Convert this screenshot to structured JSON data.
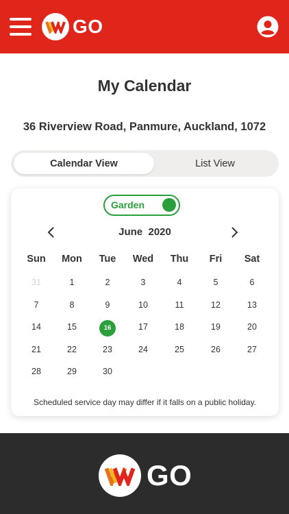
{
  "header": {
    "logo_text": "GO"
  },
  "page": {
    "title": "My Calendar",
    "address": "36 Riverview Road, Panmure, Auckland, 1072"
  },
  "view_toggle": {
    "calendar_label": "Calendar View",
    "list_label": "List View",
    "selected": "Calendar View"
  },
  "calendar": {
    "filter_label": "Garden",
    "filter_on": true,
    "month_label": "June  2020",
    "weekdays": [
      "Sun",
      "Mon",
      "Tue",
      "Wed",
      "Thu",
      "Fri",
      "Sat"
    ],
    "days": [
      "31",
      "1",
      "2",
      "3",
      "4",
      "5",
      "6",
      "7",
      "8",
      "9",
      "10",
      "11",
      "12",
      "13",
      "14",
      "15",
      "16",
      "17",
      "18",
      "19",
      "20",
      "21",
      "22",
      "23",
      "24",
      "25",
      "26",
      "27",
      "28",
      "29",
      "30"
    ],
    "service_day": "16",
    "note": "Scheduled service day may differ if it falls on a public holiday."
  },
  "colors": {
    "brand_red": "#e0251b",
    "service_green": "#2a9f3c",
    "footer_dark": "#2c2c2d"
  },
  "icons": {
    "menu": "hamburger-menu-icon",
    "user": "user-account-icon",
    "prev": "chevron-left-icon",
    "next": "chevron-right-icon"
  },
  "footer": {
    "logo_text": "GO"
  }
}
